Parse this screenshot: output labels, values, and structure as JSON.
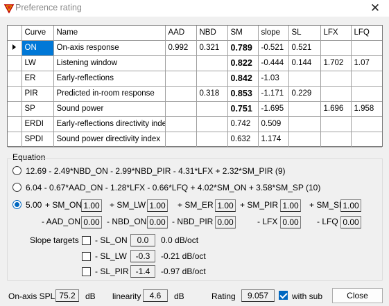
{
  "window": {
    "title": "Preference rating",
    "close_glyph": "✕",
    "icon": "app-logo-icon"
  },
  "grid": {
    "headers": [
      "Curve",
      "Name",
      "AAD",
      "NBD",
      "SM",
      "slope",
      "SL",
      "LFX",
      "LFQ"
    ],
    "selected_row": 0,
    "rows": [
      [
        "ON",
        "On-axis response",
        "0.992",
        "0.321",
        "0.789",
        "-0.521",
        "0.521",
        "",
        ""
      ],
      [
        "LW",
        "Listening window",
        "",
        "",
        "0.822",
        "-0.444",
        "0.144",
        "1.702",
        "1.07"
      ],
      [
        "ER",
        "Early-reflections",
        "",
        "",
        "0.842",
        "-1.03",
        "",
        "",
        ""
      ],
      [
        "PIR",
        "Predicted in-room response",
        "",
        "0.318",
        "0.853",
        "-1.171",
        "0.229",
        "",
        ""
      ],
      [
        "SP",
        "Sound power",
        "",
        "",
        "0.751",
        "-1.695",
        "",
        "1.696",
        "1.958"
      ],
      [
        "ERDI",
        "Early-reflections directivity index",
        "",
        "",
        "0.742",
        "0.509",
        "",
        "",
        ""
      ],
      [
        "SPDI",
        "Sound power directivity index",
        "",
        "",
        "0.632",
        "1.174",
        "",
        "",
        ""
      ]
    ],
    "bold_sm_rows": [
      0,
      1,
      2,
      3,
      4
    ]
  },
  "equation": {
    "group_label": "Equation",
    "options": [
      {
        "label": "12.69 - 2.49*NBD_ON - 2.99*NBD_PIR - 4.31*LFX + 2.32*SM_PIR (9)",
        "checked": false
      },
      {
        "label": "6.04 - 0.67*AAD_ON - 1.28*LFX - 0.66*LFQ + 4.02*SM_ON + 3.58*SM_SP (10)",
        "checked": false
      },
      {
        "label": "",
        "checked": true
      }
    ],
    "custom": {
      "base": "5.00",
      "plus_terms": [
        {
          "label": "+ SM_ON",
          "value": "1.00"
        },
        {
          "label": "+ SM_LW",
          "value": "1.00"
        },
        {
          "label": "+ SM_ER",
          "value": "1.00"
        },
        {
          "label": "+ SM_PIR",
          "value": "1.00"
        },
        {
          "label": "+ SM_SP",
          "value": "1.00"
        }
      ],
      "minus_terms": [
        {
          "label": "- AAD_ON",
          "value": "0.00"
        },
        {
          "label": "- NBD_ON",
          "value": "0.00"
        },
        {
          "label": "- NBD_PIR",
          "value": "0.00"
        },
        {
          "label": "- LFX",
          "value": "0.00"
        },
        {
          "label": "- LFQ",
          "value": "0.00"
        }
      ]
    },
    "slope_targets": {
      "label": "Slope targets",
      "items": [
        {
          "label": "- SL_ON",
          "value": "0.0",
          "unit": "0.0 dB/oct",
          "checked": false
        },
        {
          "label": "- SL_LW",
          "value": "-0.3",
          "unit": "-0.21 dB/oct",
          "checked": false
        },
        {
          "label": "- SL_PIR",
          "value": "-1.4",
          "unit": "-0.97 dB/oct",
          "checked": false
        }
      ]
    }
  },
  "footer": {
    "spl_label": "On-axis SPL",
    "spl_value": "75.2",
    "spl_unit": "dB",
    "linearity_label": "linearity",
    "linearity_value": "4.6",
    "linearity_unit": "dB",
    "rating_label": "Rating",
    "rating_value": "9.057",
    "with_sub_label": "with sub",
    "with_sub_checked": true,
    "close_label": "Close"
  }
}
